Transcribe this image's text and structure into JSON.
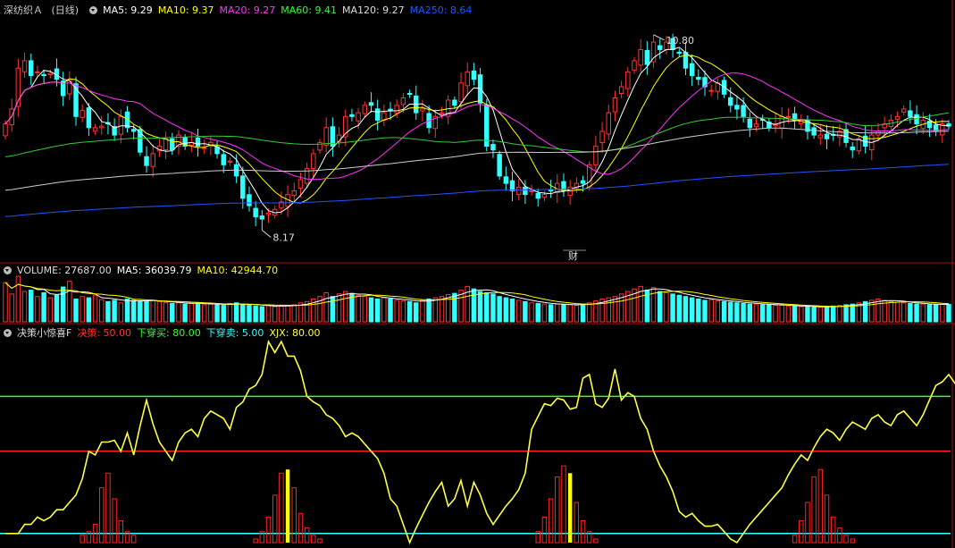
{
  "main_panel": {
    "stock_name": "深纺织Ａ",
    "period": "(日线)",
    "ma_legend": [
      {
        "label": "MA5: 9.29",
        "color": "#ffffff"
      },
      {
        "label": "MA10: 9.37",
        "color": "#ffff00"
      },
      {
        "label": "MA20: 9.27",
        "color": "#ff33ff"
      },
      {
        "label": "MA60: 9.41",
        "color": "#33ff33"
      },
      {
        "label": "MA120: 9.27",
        "color": "#dddddd"
      },
      {
        "label": "MA250: 8.64",
        "color": "#2255ff"
      }
    ],
    "high_label": "10.80",
    "low_label": "8.17",
    "event_marker": "财"
  },
  "volume_panel": {
    "legend": [
      {
        "label": "VOLUME: 27687.00",
        "color": "#dddddd"
      },
      {
        "label": "MA5: 36039.79",
        "color": "#ffffff"
      },
      {
        "label": "MA10: 42944.70",
        "color": "#ffff00"
      }
    ]
  },
  "indicator_panel": {
    "legend": [
      {
        "label": "决策小惊喜F",
        "color": "#dddddd"
      },
      {
        "label": "决策: 50.00",
        "color": "#ff3333"
      },
      {
        "label": "下穿买: 80.00",
        "color": "#33ff33"
      },
      {
        "label": "下穿卖: 5.00",
        "color": "#33ffff"
      },
      {
        "label": "XJX: 80.00",
        "color": "#ffff44"
      }
    ]
  },
  "chart_data": [
    {
      "type": "candlestick",
      "y_range": [
        7.9,
        11.05
      ],
      "series_count": 148,
      "close": [
        9.6,
        9.8,
        10.35,
        10.45,
        10.25,
        10.3,
        10.25,
        10.28,
        10.2,
        9.98,
        10.2,
        9.7,
        9.78,
        9.55,
        9.55,
        9.57,
        9.6,
        9.45,
        9.7,
        9.55,
        9.5,
        9.22,
        9.04,
        9.2,
        9.3,
        9.4,
        9.25,
        9.45,
        9.3,
        9.35,
        9.3,
        9.28,
        9.35,
        9.2,
        9.05,
        9.1,
        8.9,
        8.6,
        8.5,
        8.35,
        8.32,
        8.4,
        8.45,
        8.55,
        8.65,
        8.7,
        8.85,
        9.0,
        9.2,
        9.35,
        9.55,
        9.3,
        9.45,
        9.7,
        9.7,
        9.75,
        9.85,
        9.85,
        9.65,
        9.75,
        9.78,
        9.85,
        9.95,
        10.0,
        9.75,
        9.8,
        9.55,
        9.7,
        9.75,
        9.92,
        9.85,
        10.15,
        10.3,
        10.2,
        9.88,
        9.3,
        9.25,
        8.9,
        8.8,
        8.7,
        8.75,
        8.65,
        8.7,
        8.6,
        8.65,
        8.7,
        8.8,
        8.7,
        8.75,
        8.8,
        8.8,
        9.05,
        9.3,
        9.5,
        9.75,
        9.95,
        10.1,
        10.3,
        10.45,
        10.6,
        10.4,
        10.7,
        10.6,
        10.7,
        10.6,
        10.55,
        10.35,
        10.25,
        10.2,
        10.1,
        10.05,
        10.15,
        10.0,
        9.85,
        9.8,
        9.7,
        9.55,
        9.6,
        9.65,
        9.55,
        9.6,
        9.7,
        9.7,
        9.65,
        9.65,
        9.5,
        9.45,
        9.45,
        9.4,
        9.45,
        9.5,
        9.35,
        9.25,
        9.4,
        9.3,
        9.45,
        9.5,
        9.6,
        9.65,
        9.7,
        9.8,
        9.7,
        9.6,
        9.65,
        9.55,
        9.5,
        9.6,
        9.57
      ],
      "high": 10.8,
      "low": 8.17,
      "moving_averages": [
        "MA5",
        "MA10",
        "MA20",
        "MA60",
        "MA120",
        "MA250"
      ]
    },
    {
      "type": "bar",
      "name": "VOLUME",
      "values": [
        62000,
        44000,
        72000,
        48000,
        50000,
        40000,
        46000,
        38000,
        42000,
        55000,
        64000,
        36000,
        40000,
        38000,
        42000,
        35000,
        32000,
        34000,
        30000,
        36000,
        34000,
        33000,
        32000,
        34000,
        32000,
        30000,
        29000,
        30000,
        28000,
        29000,
        30000,
        27000,
        28000,
        27000,
        26000,
        29000,
        30000,
        27000,
        26000,
        25000,
        24000,
        26000,
        24000,
        25000,
        26000,
        27000,
        30000,
        32000,
        36000,
        40000,
        46000,
        40000,
        44000,
        48000,
        45000,
        42000,
        40000,
        38000,
        36000,
        38000,
        36000,
        34000,
        33000,
        32000,
        30000,
        34000,
        36000,
        38000,
        40000,
        43000,
        45000,
        50000,
        56000,
        52000,
        48000,
        46000,
        44000,
        40000,
        38000,
        36000,
        34000,
        32000,
        30000,
        29000,
        28000,
        27000,
        28000,
        27000,
        27000,
        26000,
        28000,
        30000,
        33000,
        36000,
        38000,
        40000,
        44000,
        48000,
        52000,
        56000,
        50000,
        54000,
        48000,
        46000,
        44000,
        42000,
        40000,
        38000,
        36000,
        34000,
        35000,
        33000,
        32000,
        31000,
        30000,
        29000,
        28000,
        28000,
        27000,
        27000,
        26000,
        26000,
        25000,
        25000,
        24000,
        24000,
        23000,
        23000,
        24000,
        25000,
        26000,
        27000,
        28000,
        30000,
        32000,
        34000,
        36000,
        34000,
        32000,
        31000,
        30000,
        29000,
        28000,
        28000,
        27000,
        27000,
        28000,
        27687
      ],
      "ma5": 36039.79,
      "ma10": 42944.7
    },
    {
      "type": "line",
      "name": "决策小惊喜F",
      "y_range": [
        0,
        112
      ],
      "reference_lines": {
        "下穿买": 80,
        "决策": 50,
        "下穿卖": 5
      },
      "xjx": [
        5,
        5,
        5,
        10,
        10,
        14,
        12,
        14,
        18,
        18,
        22,
        26,
        35,
        50,
        48,
        55,
        55,
        56,
        50,
        60,
        48,
        64,
        78,
        65,
        55,
        50,
        45,
        55,
        60,
        62,
        58,
        68,
        72,
        70,
        68,
        62,
        74,
        77,
        84,
        86,
        92,
        110,
        104,
        110,
        102,
        102,
        94,
        80,
        77,
        75,
        70,
        68,
        64,
        58,
        60,
        58,
        54,
        50,
        46,
        38,
        24,
        20,
        10,
        0,
        8,
        15,
        22,
        28,
        33,
        20,
        24,
        34,
        20,
        33,
        26,
        16,
        10,
        15,
        20,
        24,
        29,
        38,
        62,
        69,
        76,
        75,
        79,
        78,
        73,
        74,
        90,
        92,
        76,
        74,
        79,
        95,
        78,
        82,
        80,
        68,
        62,
        50,
        42,
        36,
        28,
        17,
        14,
        16,
        12,
        9,
        9,
        10,
        6,
        2,
        0,
        5,
        10,
        14,
        18,
        22,
        26,
        30,
        37,
        43,
        48,
        45,
        52,
        58,
        62,
        60,
        56,
        62,
        66,
        64,
        62,
        68,
        70,
        66,
        64,
        70,
        72,
        68,
        64,
        70,
        78,
        86,
        88,
        92,
        87,
        80
      ],
      "bars": [
        0,
        0,
        0,
        0,
        0,
        0,
        0,
        0,
        0,
        0,
        0,
        0,
        4,
        6,
        10,
        30,
        38,
        24,
        12,
        6,
        4,
        0,
        0,
        0,
        0,
        0,
        0,
        0,
        0,
        0,
        0,
        0,
        0,
        0,
        0,
        0,
        0,
        0,
        0,
        2,
        6,
        14,
        26,
        38,
        40,
        30,
        16,
        8,
        4,
        2,
        0,
        0,
        0,
        0,
        0,
        0,
        0,
        0,
        0,
        0,
        0,
        0,
        0,
        0,
        0,
        0,
        0,
        0,
        0,
        0,
        0,
        0,
        0,
        0,
        0,
        0,
        0,
        0,
        0,
        0,
        0,
        0,
        0,
        6,
        14,
        24,
        36,
        42,
        38,
        22,
        12,
        6,
        2,
        0,
        0,
        0,
        0,
        0,
        0,
        0,
        0,
        0,
        0,
        0,
        0,
        0,
        0,
        0,
        0,
        0,
        0,
        0,
        0,
        0,
        0,
        0,
        0,
        0,
        0,
        0,
        0,
        0,
        0,
        4,
        12,
        22,
        36,
        40,
        26,
        14,
        8,
        4,
        2,
        0,
        0,
        0,
        0,
        0,
        0,
        0,
        0,
        0,
        0,
        0,
        0,
        0,
        0,
        0,
        0,
        0,
        0,
        0
      ],
      "highlight_bars_at": [
        44,
        88
      ]
    }
  ]
}
